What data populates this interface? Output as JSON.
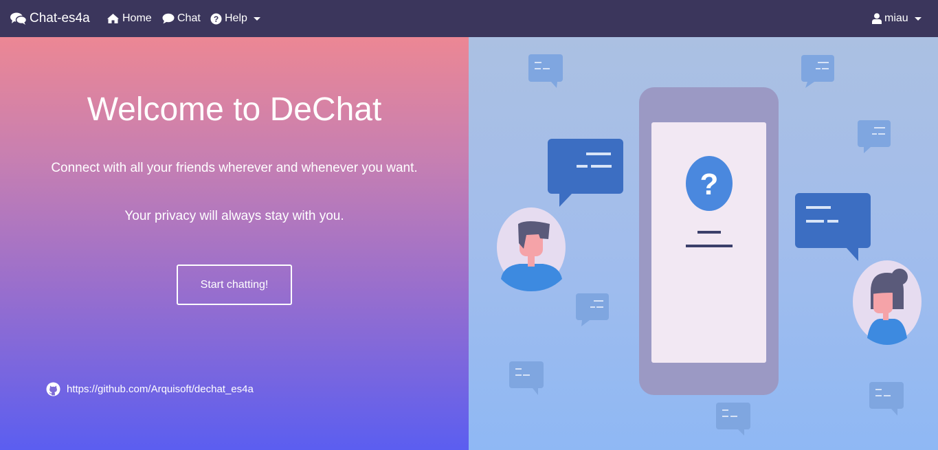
{
  "navbar": {
    "brand": "Chat-es4a",
    "home": "Home",
    "chat": "Chat",
    "help": "Help",
    "user": "miau",
    "bg_color": "#3b365c"
  },
  "hero": {
    "title": "Welcome to DeChat",
    "tagline": "Connect with all your friends wherever and whenever you want.",
    "privacy": "Your privacy will always stay with you.",
    "start_button": "Start chatting!",
    "github_link": "https://github.com/Arquisoft/dechat_es4a"
  },
  "illustration": {
    "phone_icon": "question-icon",
    "accent_color": "#3c6ec2"
  }
}
